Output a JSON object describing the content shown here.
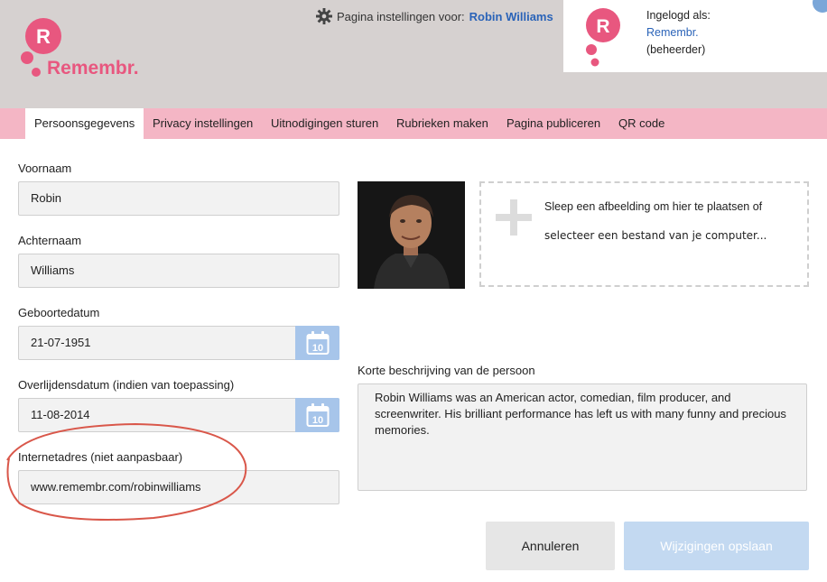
{
  "header": {
    "logo_text": "Remembr.",
    "logo_letter": "R",
    "settings_prefix": "Pagina instellingen voor:",
    "settings_owner": "Robin Williams"
  },
  "login": {
    "line1": "Ingelogd als:",
    "username": "Remembr.",
    "role": "(beheerder)",
    "logo_letter": "R"
  },
  "tabs": [
    {
      "label": "Persoonsgegevens",
      "active": true
    },
    {
      "label": "Privacy instellingen"
    },
    {
      "label": "Uitnodigingen sturen"
    },
    {
      "label": "Rubrieken maken"
    },
    {
      "label": "Pagina publiceren"
    },
    {
      "label": "QR code"
    }
  ],
  "form": {
    "first_name": {
      "label": "Voornaam",
      "value": "Robin"
    },
    "last_name": {
      "label": "Achternaam",
      "value": "Williams"
    },
    "birth_date": {
      "label": "Geboortedatum",
      "value": "21-07-1951"
    },
    "death_date": {
      "label": "Overlijdensdatum (indien van toepassing)",
      "value": "11-08-2014"
    },
    "url": {
      "label": "Internetadres (niet aanpasbaar)",
      "value": "www.remembr.com/robinwilliams"
    },
    "calendar_day": "10"
  },
  "upload": {
    "line1": "Sleep een afbeelding om hier te plaatsen of",
    "line2": "selecteer een bestand van je computer..."
  },
  "description": {
    "label": "Korte beschrijving van de persoon",
    "value": "Robin Williams was an American actor, comedian, film producer, and screenwriter. His brilliant performance has left us with many funny and precious memories."
  },
  "buttons": {
    "cancel": "Annuleren",
    "save": "Wijzigingen opslaan"
  },
  "colors": {
    "brand_pink": "#e8577f",
    "tab_bar": "#f4b6c5",
    "header_bg": "#d6d1d0",
    "link_blue": "#2a63b8",
    "calendar_blue": "#a7c5ea",
    "annotation_red": "#d9574a"
  },
  "icons": [
    "gear-icon",
    "calendar-icon",
    "plus-icon"
  ]
}
